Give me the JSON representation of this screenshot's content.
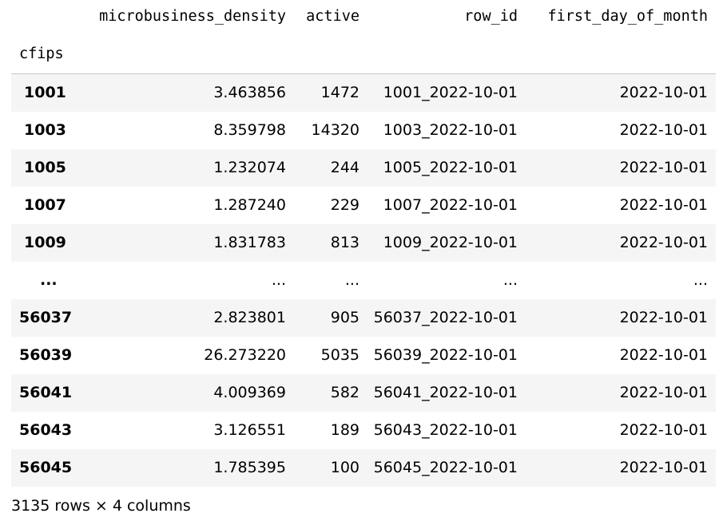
{
  "table": {
    "columns": [
      "microbusiness_density",
      "active",
      "row_id",
      "first_day_of_month"
    ],
    "index_name": "cfips",
    "rows": [
      {
        "index": "1001",
        "cells": [
          "3.463856",
          "1472",
          "1001_2022-10-01",
          "2022-10-01"
        ]
      },
      {
        "index": "1003",
        "cells": [
          "8.359798",
          "14320",
          "1003_2022-10-01",
          "2022-10-01"
        ]
      },
      {
        "index": "1005",
        "cells": [
          "1.232074",
          "244",
          "1005_2022-10-01",
          "2022-10-01"
        ]
      },
      {
        "index": "1007",
        "cells": [
          "1.287240",
          "229",
          "1007_2022-10-01",
          "2022-10-01"
        ]
      },
      {
        "index": "1009",
        "cells": [
          "1.831783",
          "813",
          "1009_2022-10-01",
          "2022-10-01"
        ]
      },
      {
        "index": "...",
        "cells": [
          "...",
          "...",
          "...",
          "..."
        ]
      },
      {
        "index": "56037",
        "cells": [
          "2.823801",
          "905",
          "56037_2022-10-01",
          "2022-10-01"
        ]
      },
      {
        "index": "56039",
        "cells": [
          "26.273220",
          "5035",
          "56039_2022-10-01",
          "2022-10-01"
        ]
      },
      {
        "index": "56041",
        "cells": [
          "4.009369",
          "582",
          "56041_2022-10-01",
          "2022-10-01"
        ]
      },
      {
        "index": "56043",
        "cells": [
          "3.126551",
          "189",
          "56043_2022-10-01",
          "2022-10-01"
        ]
      },
      {
        "index": "56045",
        "cells": [
          "1.785395",
          "100",
          "56045_2022-10-01",
          "2022-10-01"
        ]
      }
    ]
  },
  "footer": {
    "text": "3135 rows × 4 columns"
  }
}
